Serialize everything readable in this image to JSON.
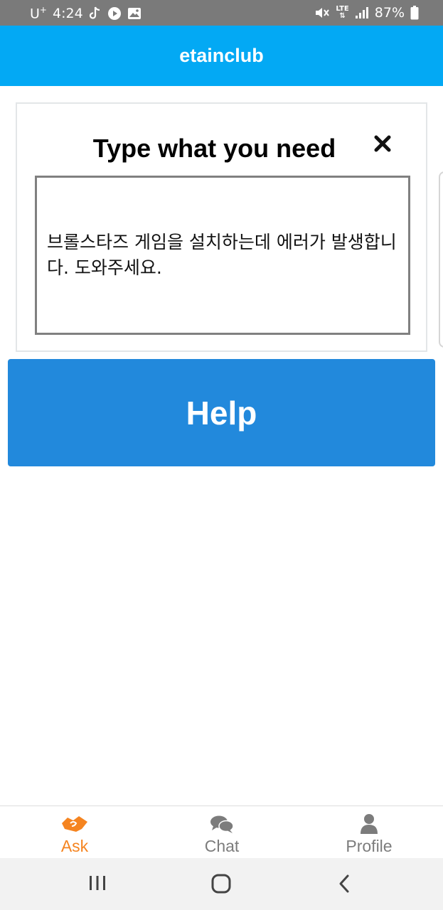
{
  "status_bar": {
    "carrier": "U",
    "carrier_sup": "+",
    "time": "4:24",
    "network": "LTE",
    "battery": "87%"
  },
  "app_bar": {
    "title": "etainclub"
  },
  "dialog": {
    "title": "Type what you need",
    "close_icon": "close-icon",
    "text": "브롤스타즈 게임을 설치하는데 에러가 발생합니다. 도와주세요."
  },
  "help_button": {
    "label": "Help"
  },
  "bottom_nav": {
    "items": [
      {
        "label": "Ask",
        "icon": "handshake-icon",
        "active": true
      },
      {
        "label": "Chat",
        "icon": "chat-bubbles-icon",
        "active": false
      },
      {
        "label": "Profile",
        "icon": "person-icon",
        "active": false
      }
    ],
    "active_color": "#f58420",
    "inactive_color": "#7c7c7c"
  },
  "colors": {
    "app_bar": "#03a9f4",
    "help_button": "#2289dc",
    "status_bar": "#7a7a7a"
  }
}
